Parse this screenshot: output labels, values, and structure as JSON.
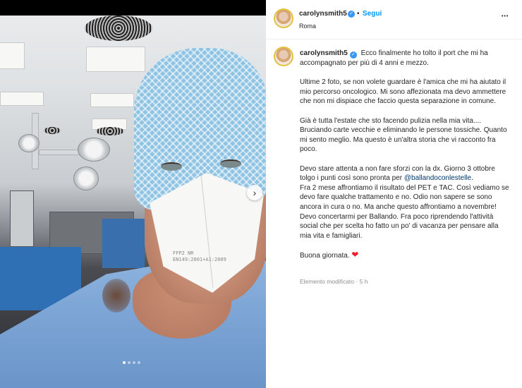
{
  "post": {
    "username": "carolynsmith5",
    "follow_label": "Segui",
    "separator": "•",
    "location": "Roma",
    "more_label": "•••"
  },
  "caption": {
    "username": "carolynsmith5",
    "paragraphs": [
      "Ecco finalmente ho tolto il port che mi ha accompagnato per più di 4 anni e mezzo.",
      "Ultime 2 foto, se non volete guardare è l'amica che mi ha aiutato il mio percorso oncologico. Mi sono affezionata ma devo ammettere che non mi dispiace che faccio questa separazione in comune.",
      "Già è tutta l'estate che sto facendo pulizia nella mia vita.... Bruciando carte vecchie e eliminando le persone tossiche. Quanto mi sento meglio. Ma questo è un'altra storia che vi racconto fra poco.",
      "Fra 2 mese affrontiamo il risultato del PET e TAC. Così vediamo se devo fare qualche trattamento e no. Odio non sapere se sono ancora in cura o no. Ma anche questo affrontiamo a novembre! Devo concertarmi per Ballando. Fra poco riprendendo l'attività social che per scelta ho fatto un po' di vacanza per pensare alla mia vita e famigliari.",
      "Buona giornata."
    ],
    "p4_prefix": "Devo stare attenta a non fare sforzi con la dx. Giorno 3 ottobre tolgo i punti così sono pronta per ",
    "mention": "@ballandoconlestelle",
    "p4_suffix": ".",
    "heart": "❤",
    "edited_label": "Elemento modificato",
    "time_sep": "·",
    "time": "5 h"
  },
  "photo": {
    "mask_text": "FFP2 NR EN149:2001+A1:2009",
    "carousel_count": 4,
    "carousel_active": 1,
    "next_icon": "›"
  },
  "colors": {
    "accent": "#0095f6",
    "verified": "#3897f0",
    "heart": "#ed1c2e",
    "meta_text": "#8e8e8e"
  }
}
